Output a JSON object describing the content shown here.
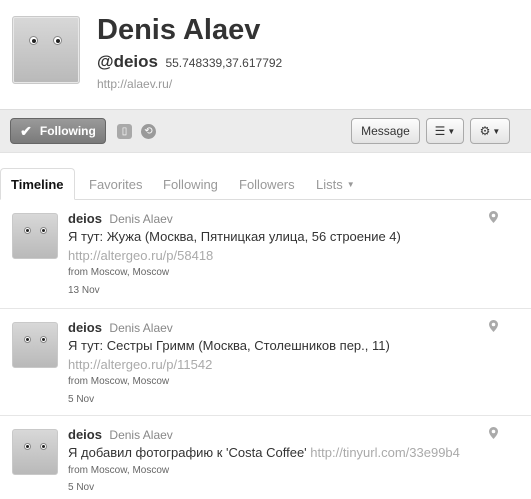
{
  "profile": {
    "name": "Denis Alaev",
    "handle": "@deios",
    "coords": "55.748339,37.617792",
    "url": "http://alaev.ru/"
  },
  "actions": {
    "following_label": "Following",
    "message_label": "Message",
    "list_icon": "list-icon",
    "gear_icon": "gear-icon"
  },
  "tabs": [
    {
      "label": "Timeline",
      "active": true
    },
    {
      "label": "Favorites"
    },
    {
      "label": "Following"
    },
    {
      "label": "Followers"
    },
    {
      "label": "Lists"
    }
  ],
  "tweets": [
    {
      "user": "deios",
      "name": "Denis Alaev",
      "text": "Я тут: Жужа (Москва, Пятницкая улица, 56 строение 4)",
      "link": "http://altergeo.ru/p/58418",
      "from": "from Moscow, Moscow",
      "date": "13 Nov"
    },
    {
      "user": "deios",
      "name": "Denis Alaev",
      "text": "Я тут: Сестры Гримм (Москва, Столешников пер., 11)",
      "link": "http://altergeo.ru/p/11542",
      "from": "from Moscow, Moscow",
      "date": "5 Nov"
    },
    {
      "user": "deios",
      "name": "Denis Alaev",
      "text": "Я добавил фотографию к 'Costa Coffee'",
      "link": "http://tinyurl.com/33e99b4",
      "from": "from Moscow, Moscow",
      "date": "5 Nov"
    }
  ]
}
